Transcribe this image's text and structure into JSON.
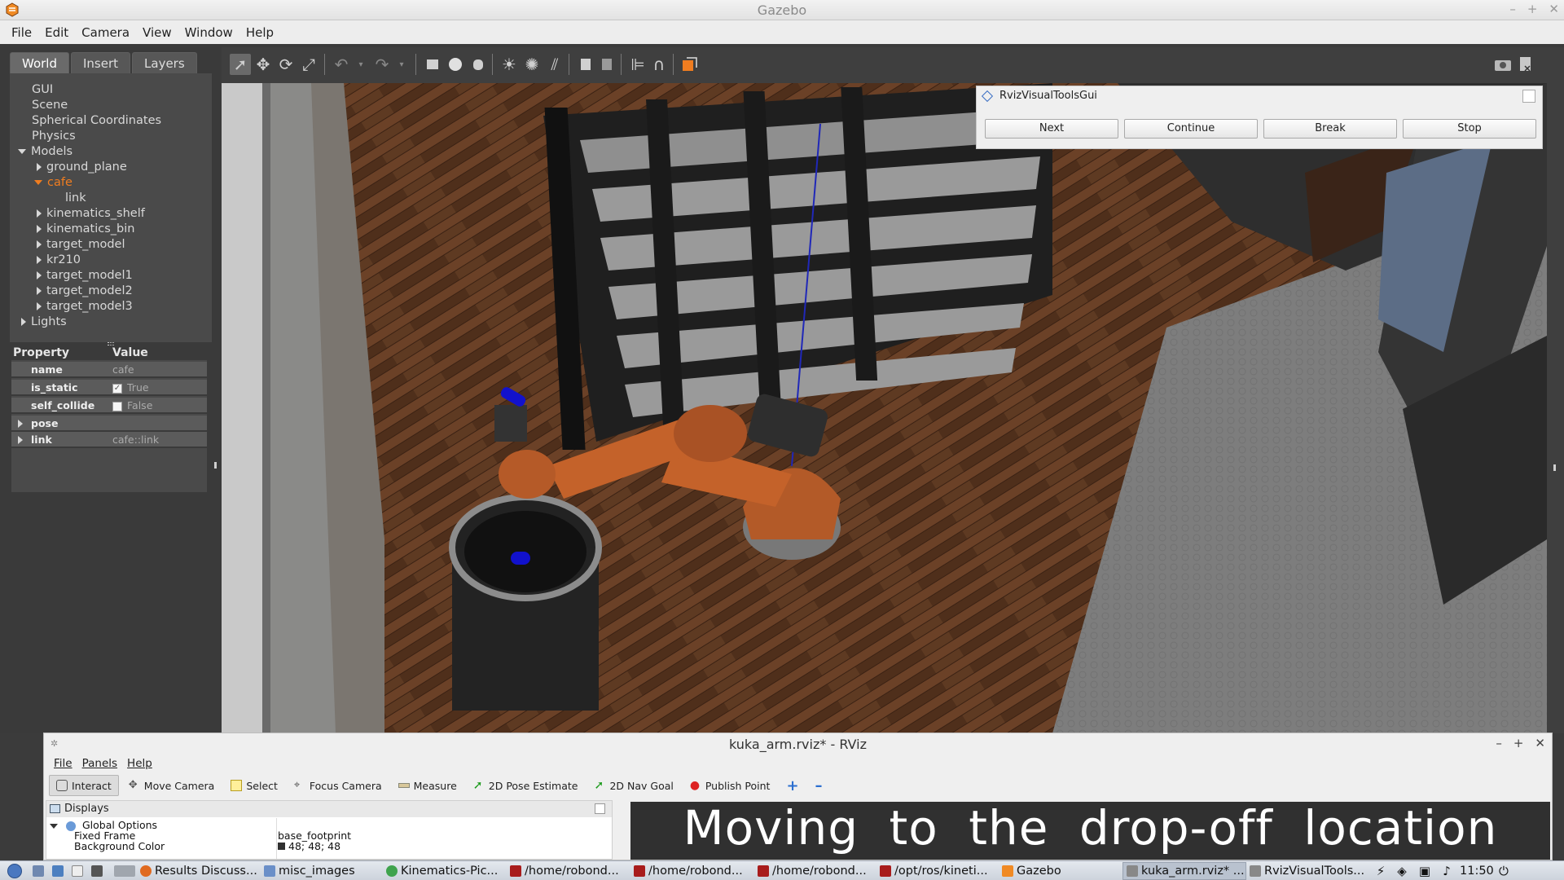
{
  "gazebo": {
    "title": "Gazebo",
    "menu": [
      "File",
      "Edit",
      "Camera",
      "View",
      "Window",
      "Help"
    ],
    "tabs": [
      "World",
      "Insert",
      "Layers"
    ],
    "tree": {
      "gui": "GUI",
      "scene": "Scene",
      "spherical": "Spherical Coordinates",
      "physics": "Physics",
      "models": "Models",
      "ground_plane": "ground_plane",
      "cafe": "cafe",
      "link": "link",
      "kinematics_shelf": "kinematics_shelf",
      "kinematics_bin": "kinematics_bin",
      "target_model": "target_model",
      "kr210": "kr210",
      "target_model1": "target_model1",
      "target_model2": "target_model2",
      "target_model3": "target_model3",
      "lights": "Lights"
    },
    "properties": {
      "header_property": "Property",
      "header_value": "Value",
      "name_key": "name",
      "name_val": "cafe",
      "is_static_key": "is_static",
      "is_static_val": "True",
      "self_collide_key": "self_collide",
      "self_collide_val": "False",
      "pose_key": "pose",
      "link_key": "link",
      "link_val": "cafe::link"
    }
  },
  "rvt_gui": {
    "title": "RvizVisualToolsGui",
    "buttons": [
      "Next",
      "Continue",
      "Break",
      "Stop"
    ]
  },
  "rviz": {
    "title": "kuka_arm.rviz* - RViz",
    "menu": [
      "File",
      "Panels",
      "Help"
    ],
    "tools": [
      "Interact",
      "Move Camera",
      "Select",
      "Focus Camera",
      "Measure",
      "2D Pose Estimate",
      "2D Nav Goal",
      "Publish Point"
    ],
    "displays_title": "Displays",
    "global_options": "Global Options",
    "fixed_frame_key": "Fixed Frame",
    "fixed_frame_val": "base_footprint",
    "bg_color_key": "Background Color",
    "bg_color_val": "48; 48; 48",
    "overlay_text": "Moving to the drop-off location"
  },
  "taskbar": {
    "items": [
      "Results Discuss...",
      "misc_images",
      "Kinematics-Pic...",
      "/home/robond...",
      "/home/robond...",
      "/home/robond...",
      "/opt/ros/kineti...",
      "Gazebo",
      "kuka_arm.rviz* ...",
      "RvizVisualTools..."
    ],
    "clock": "11:50"
  },
  "colors": {
    "accent_orange": "#f07d20",
    "rviz_bg": "#303030"
  }
}
